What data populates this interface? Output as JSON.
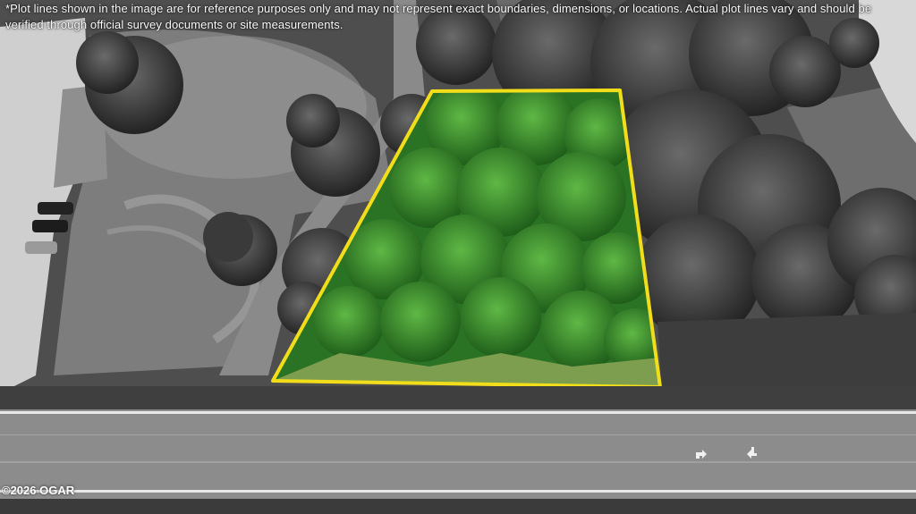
{
  "disclaimer": "*Plot lines shown in the image are for reference purposes only and may not represent exact boundaries, dimensions, or locations. Actual plot lines vary and should be verified through official survey documents or site measurements.",
  "copyright": "©2026 OGAR",
  "colors": {
    "plot_outline": "#f2dd1b",
    "foliage": "#2f8a26",
    "road": "#8c8c8c"
  },
  "icons": [
    "turn-right-arrow-icon",
    "turn-left-arrow-icon"
  ]
}
